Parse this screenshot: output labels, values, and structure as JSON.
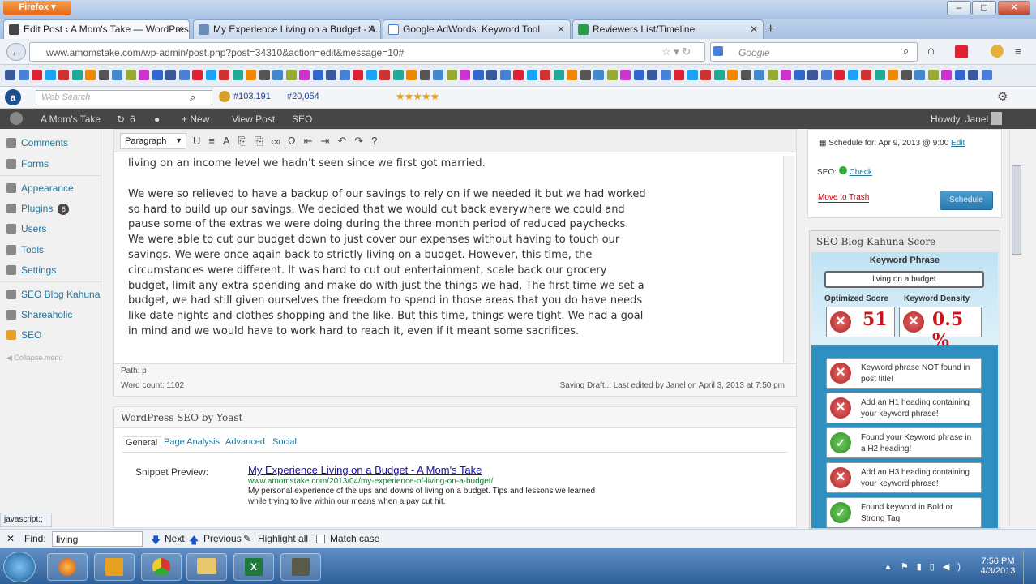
{
  "browser": {
    "app_button": "Firefox",
    "tabs": [
      {
        "label": "Edit Post ‹ A Mom's Take — WordPress"
      },
      {
        "label": "My Experience Living on a Budget - A..."
      },
      {
        "label": "Google AdWords: Keyword Tool"
      },
      {
        "label": "Reviewers List/Timeline"
      }
    ],
    "new_tab": "+",
    "url": "www.amomstake.com/wp-admin/post.php?post=34310&action=edit&message=10#",
    "url_domain": "amomstake.com",
    "search_engine": "Google",
    "search_placeholder": "Google",
    "toolbar2": {
      "web_search_placeholder": "Web Search",
      "rank1": "#103,191",
      "rank2": "#20,054"
    }
  },
  "admin_bar": {
    "site": "A Mom's Take",
    "updates": "6",
    "new": "+ New",
    "view_post": "View Post",
    "seo": "SEO",
    "howdy": "Howdy, Janel"
  },
  "sidebar": {
    "items": [
      {
        "label": "Comments"
      },
      {
        "label": "Forms"
      },
      {
        "label": "Appearance"
      },
      {
        "label": "Plugins",
        "badge": "6"
      },
      {
        "label": "Users"
      },
      {
        "label": "Tools"
      },
      {
        "label": "Settings"
      },
      {
        "label": "SEO Blog Kahuna"
      },
      {
        "label": "Shareaholic"
      },
      {
        "label": "SEO"
      }
    ],
    "collapse": "Collapse menu"
  },
  "editor": {
    "format": "Paragraph",
    "paragraphs": [
      "living on an income level we hadn't seen since we first got married.",
      "We were so relieved to have a backup of our savings to rely on if we needed it but we had worked so hard to build up our savings. We decided that we would cut back everywhere we could and pause some of the extras we were doing during the three month period of reduced paychecks. We were able to cut our budget down to just cover our expenses without having to touch our savings. We were once again back to strictly living on a budget. However, this time, the circumstances were different. It was hard to cut out entertainment, scale back our grocery budget, limit any extra spending and make do with just the things we had. The first time we set a budget, we had still given ourselves the freedom to spend in those areas that you do have needs like date nights and clothes shopping and the like. But this time, things were tight. We had a goal in mind and we would have to work hard to reach it, even if it meant some sacrifices."
    ],
    "path": "Path: p",
    "word_count": "Word count: 1102",
    "saving": "Saving Draft... Last edited by Janel on April 3, 2013 at 7:50 pm"
  },
  "yoast": {
    "title": "WordPress SEO by Yoast",
    "tabs": [
      "General",
      "Page Analysis",
      "Advanced",
      "Social"
    ],
    "snippet_label": "Snippet Preview:",
    "snippet_title": "My Experience Living on a Budget - A Mom's Take",
    "snippet_url": "www.amomstake.com/2013/04/my-experience-of-living-on-a-budget/",
    "snippet_desc": "My personal experience of the ups and downs of living on a budget. Tips and lessons we learned while trying to live within our means when a pay cut hit."
  },
  "publish": {
    "schedule": "Schedule for: Apr 9, 2013 @ 9:00",
    "edit": "Edit",
    "seo_label": "SEO:",
    "check": "Check",
    "trash": "Move to Trash",
    "schedule_button": "Schedule"
  },
  "kahuna": {
    "title": "SEO Blog Kahuna Score",
    "keyword_label": "Keyword Phrase",
    "keyword": "living on a budget",
    "opt_label": "Optimized Score",
    "density_label": "Keyword Density",
    "score": "51",
    "density": "0.5 %",
    "checks": [
      {
        "text": "Keyword phrase NOT found in post title!",
        "ok": false
      },
      {
        "text": "Add an H1 heading containing your keyword phrase!",
        "ok": false
      },
      {
        "text": "Found your Keyword phrase in a H2 heading!",
        "ok": true
      },
      {
        "text": "Add an H3 heading containing your keyword phrase!",
        "ok": false
      },
      {
        "text": "Found keyword in Bold or Strong Tag!",
        "ok": true
      }
    ]
  },
  "status_bar": "javascript:;",
  "find": {
    "label": "Find:",
    "value": "living",
    "next": "Next",
    "previous": "Previous",
    "highlight": "Highlight all",
    "match_case": "Match case"
  },
  "clock": {
    "time": "7:56 PM",
    "date": "4/3/2013"
  }
}
